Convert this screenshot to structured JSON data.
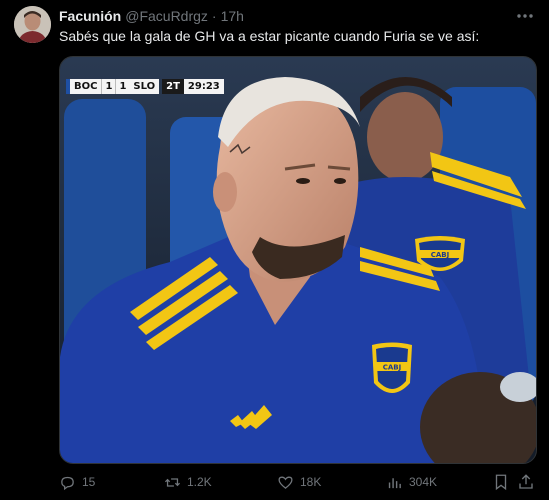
{
  "author": {
    "display_name": "Facunión",
    "handle": "@FacuRdrgz",
    "separator": "·",
    "time": "17h"
  },
  "tweet": {
    "text": "Sabés que la gala de GH va a estar picante cuando Furia se ve así:"
  },
  "scorebug": {
    "home_team": "BOC",
    "home_score": "1",
    "away_score": "1",
    "away_team": "SLO",
    "half": "2T",
    "clock": "29:23"
  },
  "badge_text": "CABJ",
  "actions": {
    "replies": "15",
    "reposts": "1.2K",
    "likes": "18K",
    "views": "304K"
  },
  "icons": [
    "more-icon",
    "reply-icon",
    "repost-icon",
    "like-icon",
    "views-icon",
    "bookmark-icon",
    "share-icon"
  ],
  "colors": {
    "background": "#000000",
    "text_primary": "#e7e9ea",
    "text_secondary": "#71767b",
    "jersey_blue": "#1f3fa6",
    "jersey_yellow": "#f2c614"
  }
}
